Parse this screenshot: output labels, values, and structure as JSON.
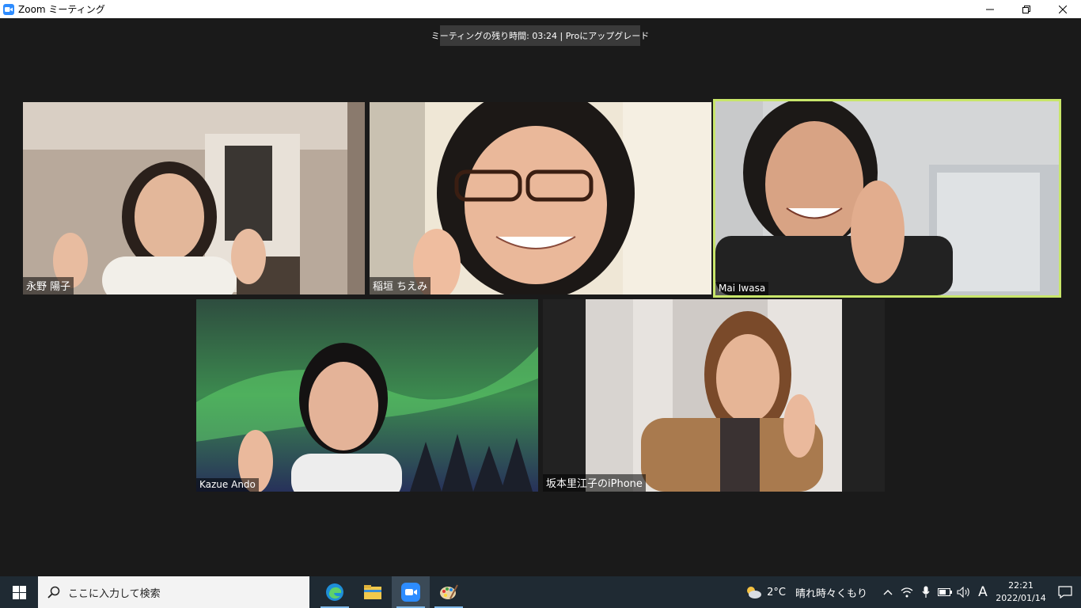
{
  "window": {
    "title": "Zoom ミーティング",
    "minimize_icon": "minimize-icon",
    "restore_icon": "restore-icon",
    "close_icon": "close-icon"
  },
  "meeting": {
    "time_banner": "ミーティングの残り時間: 03:24 | Proにアップグレード",
    "active_speaker_color": "#c8e66a",
    "participants": [
      {
        "name": "永野 陽子"
      },
      {
        "name": "稲垣 ちえみ"
      },
      {
        "name": "Mai Iwasa",
        "active_speaker": true
      },
      {
        "name": "Kazue Ando"
      },
      {
        "name": "坂本里江子のiPhone"
      }
    ]
  },
  "taskbar": {
    "search_placeholder": "ここに入力して検索",
    "apps": [
      "edge-icon",
      "file-explorer-icon",
      "zoom-icon",
      "paint-icon"
    ],
    "weather_temp": "2°C",
    "weather_desc": "晴れ時々くもり",
    "ime": "A",
    "time": "22:21",
    "date": "2022/01/14"
  }
}
